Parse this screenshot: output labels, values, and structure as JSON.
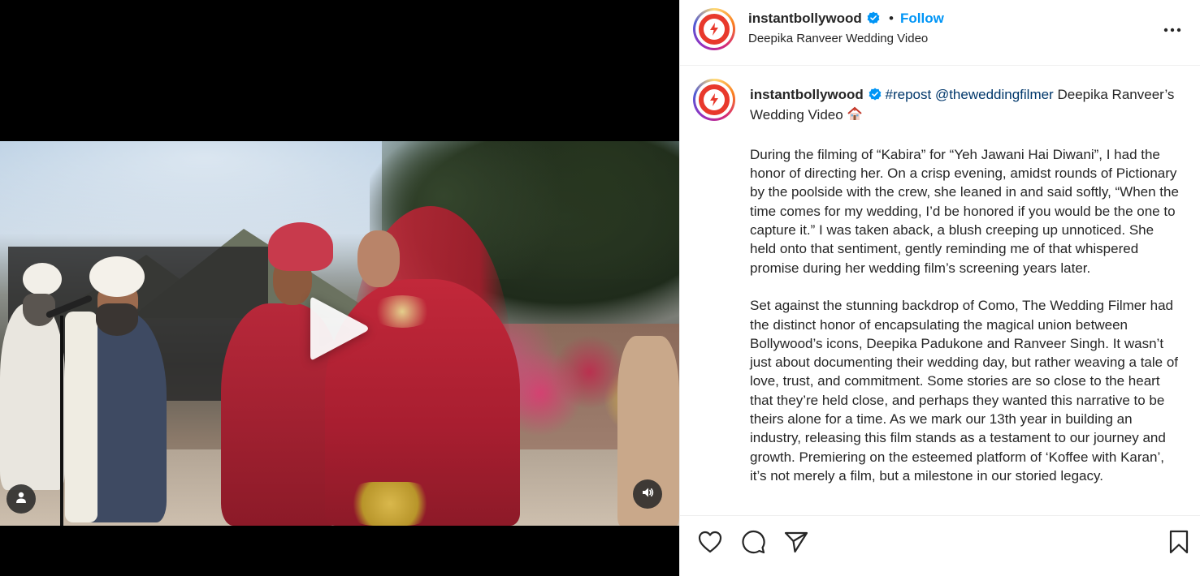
{
  "post": {
    "username": "instantbollywood",
    "dot": "•",
    "follow_label": "Follow",
    "subtitle": "Deepika Ranveer Wedding Video",
    "more_icon": "more-horizontal-icon"
  },
  "media": {
    "play_icon": "play-icon",
    "tagged_users_icon": "user-icon",
    "audio_icon": "speaker-icon"
  },
  "caption": {
    "username": "instantbollywood",
    "hashtag": "#repost",
    "mention": "@theweddingfilmer",
    "title": " Deepika Ranveer’s Wedding Video",
    "title_icon": "house-emoji-icon",
    "paragraph_1": "During the filming of “Kabira” for “Yeh Jawani Hai Diwani”, I had the honor of directing her. On a crisp evening, amidst rounds of Pictionary by the poolside with the crew, she leaned in and said softly, “When the time comes for my wedding, I’d be honored if you would be the one to capture it.” I was taken aback, a blush creeping up unnoticed. She held onto that sentiment, gently reminding me of that whispered promise during her wedding film’s screening years later.",
    "paragraph_2": "Set against the stunning backdrop of Como, The Wedding Filmer had the distinct honor of encapsulating the magical union between Bollywood’s icons, Deepika Padukone and Ranveer Singh. It wasn’t just about documenting their wedding day, but rather weaving a tale of love, trust, and commitment. Some stories are so close to the heart that they’re held close, and perhaps they wanted this narrative to be theirs alone for a time. As we mark our 13th year in building an industry, releasing this film stands as a testament to our journey and growth. Premiering on the esteemed platform of ‘Koffee with Karan’, it’s not merely a film, but a milestone in our storied legacy."
  },
  "actions": {
    "like_icon": "heart-icon",
    "comment_icon": "comment-icon",
    "share_icon": "send-icon",
    "save_icon": "bookmark-icon"
  },
  "colors": {
    "follow": "#0095f6",
    "link": "#00376b",
    "verified": "#0095f6",
    "text": "#262626",
    "divider": "#efefef"
  }
}
